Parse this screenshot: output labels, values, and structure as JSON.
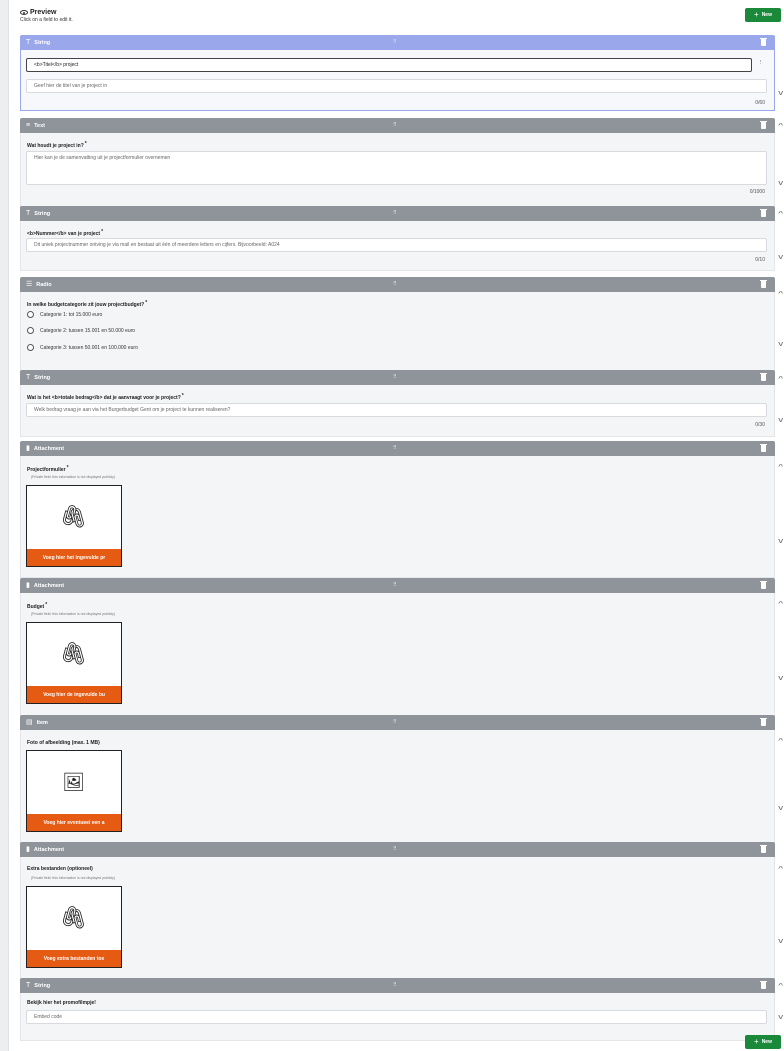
{
  "preview": {
    "title": "Preview",
    "subtitle": "Click on a field to edit it."
  },
  "new_label": "New",
  "new_plus": "+",
  "private_note": "(Private field: this information is not displayed publicly)",
  "blocks": {
    "b1": {
      "type": "String",
      "value": "<b>Titel</b> project",
      "placeholder": "Geef hier de titel van je project in",
      "counter": "0/60"
    },
    "b2": {
      "type": "Text",
      "label": "Wat houdt je project in?",
      "placeholder": "Hier kan je de samenvatting uit je projectformulier overnemen",
      "counter": "0/1000"
    },
    "b3": {
      "type": "String",
      "label": "<b>Nummer</b> van je project",
      "placeholder": "Dit uniek projectnummer ontving je via mail en bestaat uit één of meerdere letters en cijfers. Bijvoorbeeld: A024",
      "counter": "0/10"
    },
    "b4": {
      "type": "Radio",
      "label": "In welke budgetcategorie zit jouw projectbudget?",
      "options": [
        "Categorie 1: tot 15.000 euro",
        "Categorie 2: tussen 15.001 en 50.000 euro",
        "Categorie 3: tussen 50.001 en 100.000 euro"
      ]
    },
    "b5": {
      "type": "String",
      "label": "Wat is het <b>totale bedrag</b> dat je aanvraagt voor je project?",
      "placeholder": "Welk bedrag vraag je aan via het Burgerbudget Gent om je project te kunnen realiseren?",
      "counter": "0/30"
    },
    "b6": {
      "type": "Attachment",
      "label": "Projectformulier",
      "button": "Voeg hier het ingevulde pr"
    },
    "b7": {
      "type": "Attachment",
      "label": "Budget",
      "button": "Voeg hier de ingevulde bu"
    },
    "b8": {
      "type": "Item",
      "label": "Foto of afbeelding (max. 1 MB)",
      "button": "Voeg hier eventueel een a"
    },
    "b9": {
      "type": "Attachment",
      "label": "Extra bestanden (optioneel)",
      "button": "Voeg extra bestanden toe"
    },
    "b10": {
      "type": "String",
      "label": "Bekijk hier het promofilmpje!",
      "placeholder": "Embed code"
    }
  },
  "icons": {
    "string": "T",
    "text": "≡",
    "radio": "☰",
    "attachment": "▮",
    "item": "▤",
    "paperclip": "🖇",
    "image": "🖼",
    "grip": "⠿",
    "chevron_up": "^",
    "chevron_down": "v"
  },
  "colors": {
    "header": "#8f949b",
    "selected_header": "#9aa7ea",
    "new_button": "#1a8a3a",
    "upload_button": "#e55b14"
  }
}
